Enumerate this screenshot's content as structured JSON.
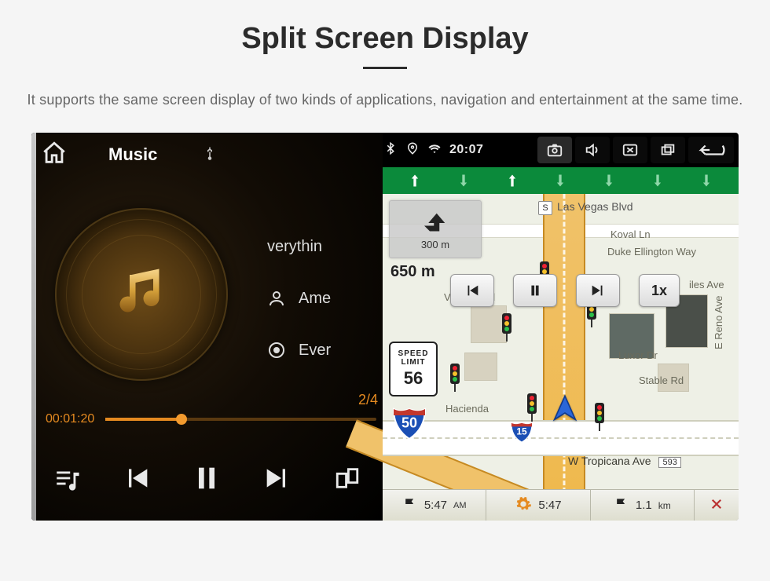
{
  "page": {
    "title": "Split Screen Display",
    "description": "It supports the same screen display of two kinds of applications, navigation and entertainment at the same time."
  },
  "music": {
    "title": "Music",
    "tracks": {
      "row1": "verythin",
      "row2": "Ame",
      "row3": "Ever"
    },
    "index": "2/4",
    "elapsed": "00:01:20"
  },
  "status": {
    "time": "20:07"
  },
  "map": {
    "turn_distance": "300 m",
    "main_distance": "650 m",
    "speed_limit": {
      "line1": "SPEED",
      "line2": "LIMIT",
      "value": "56"
    },
    "route_shield": "50",
    "interstate": "15",
    "speed_playback": "1x",
    "streets": {
      "las_vegas": "Las Vegas Blvd",
      "koval": "Koval Ln",
      "duke": "Duke Ellington Way",
      "vegas2": "Vegas Blvd",
      "luxor": "Luxor Dr",
      "stable": "Stable Rd",
      "reno": "E Reno Ave",
      "hacienda": "Hacienda",
      "tropicana": "W Tropicana Ave",
      "tropicana_tag": "593",
      "iles": "iles Ave"
    },
    "bottom": {
      "eta": "5:47",
      "eta_ampm": "AM",
      "duration": "5:47",
      "distance": "1.1",
      "distance_unit": "km"
    }
  }
}
